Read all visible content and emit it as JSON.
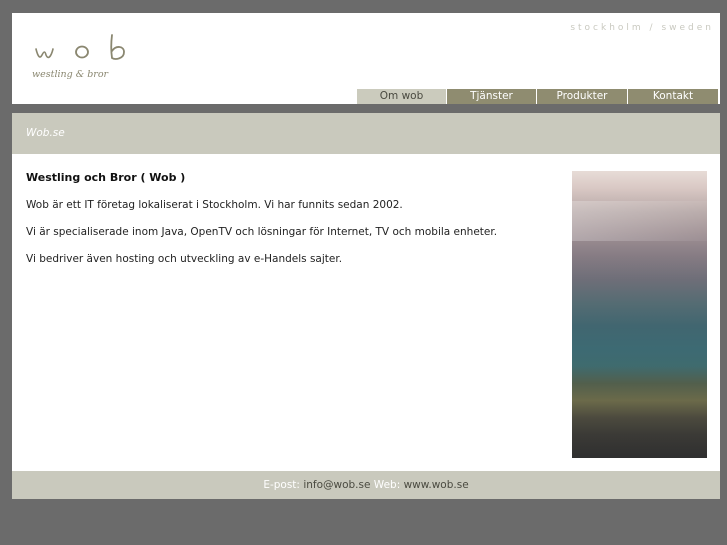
{
  "header": {
    "tagline": "stockholm / sweden",
    "logo": {
      "wordmark": "wob",
      "subtitle": "westling & bror"
    }
  },
  "nav": {
    "items": [
      {
        "label": "Om wob",
        "active": true
      },
      {
        "label": "Tjänster",
        "active": false
      },
      {
        "label": "Produkter",
        "active": false
      },
      {
        "label": "Kontakt",
        "active": false
      }
    ]
  },
  "titlebar": {
    "title": "Wob.se"
  },
  "content": {
    "heading": "Westling och Bror ( Wob )",
    "paragraphs": [
      "Wob är ett IT företag lokaliserat i Stockholm. Vi har funnits sedan 2002.",
      "Vi är specialiserade inom Java, OpenTV och lösningar för Internet, TV och mobila enheter.",
      "Vi bedriver även hosting och utveckling av e-Handels sajter."
    ]
  },
  "footer": {
    "email_label": "E-post:",
    "email": "info@wob.se",
    "web_label": "Web:",
    "web": "www.wob.se"
  },
  "colors": {
    "background": "#6b6b6b",
    "nav_bg": "#8f8c70",
    "nav_active_bg": "#cbcbbd",
    "band_bg": "#c9c9bd"
  }
}
